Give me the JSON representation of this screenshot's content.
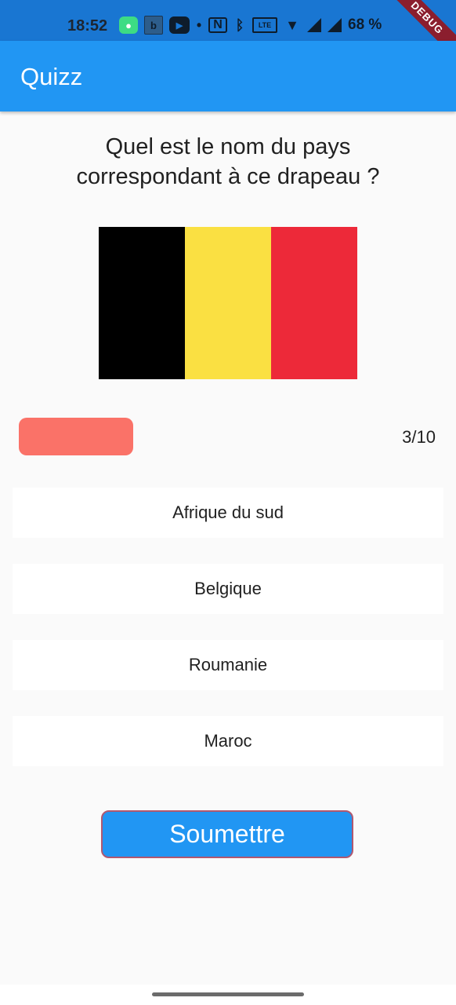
{
  "status_bar": {
    "time": "18:52",
    "battery": "68 %",
    "icons": [
      "message-icon",
      "b-icon",
      "youtube-icon",
      "dot-icon",
      "nfc-icon",
      "bluetooth-icon",
      "volte-icon",
      "wifi-icon",
      "signal-icon"
    ]
  },
  "debug_banner": "DEBUG",
  "app_bar": {
    "title": "Quizz"
  },
  "question": "Quel est le nom du pays correspondant à ce drapeau ?",
  "flag": {
    "country_colors": [
      "#000000",
      "#fae042",
      "#ed2939"
    ]
  },
  "progress": {
    "counter": "3/10",
    "current": 3,
    "total": 10,
    "color": "#fa7268"
  },
  "options": [
    "Afrique du sud",
    "Belgique",
    "Roumanie",
    "Maroc"
  ],
  "submit_label": "Soumettre",
  "colors": {
    "primary": "#2196f3",
    "status_bar": "#1976d2",
    "background": "#fafafa"
  }
}
